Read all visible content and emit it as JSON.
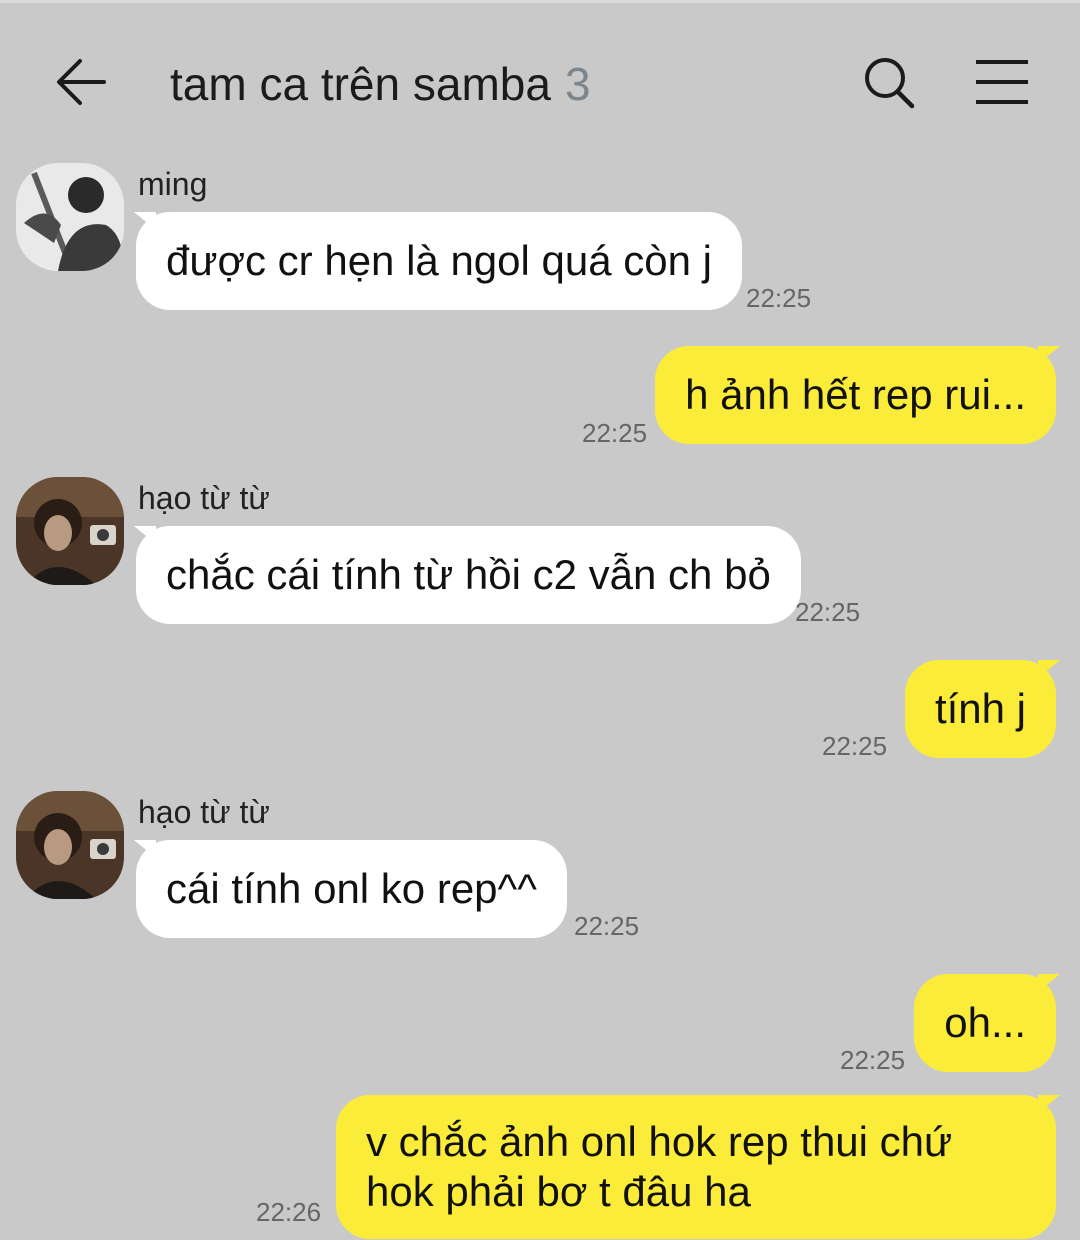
{
  "header": {
    "title": "tam ca trên samba",
    "member_count": "3",
    "back_icon": "back-arrow-icon",
    "search_icon": "search-icon",
    "menu_icon": "hamburger-menu-icon"
  },
  "colors": {
    "background": "#c9c9c9",
    "incoming_bubble": "#ffffff",
    "outgoing_bubble": "#fcec3a",
    "count_text": "#7e868d"
  },
  "messages": [
    {
      "sender": "ming",
      "text": "được cr hẹn là ngol quá còn j",
      "time": "22:25"
    },
    {
      "text": "h ảnh hết rep rui...",
      "time": "22:25"
    },
    {
      "sender": "hạo từ từ",
      "text": "chắc cái tính từ hồi c2 vẫn ch bỏ",
      "time": "22:25"
    },
    {
      "text": "tính j",
      "time": "22:25"
    },
    {
      "sender": "hạo từ từ",
      "text": "cái tính onl ko rep^^",
      "time": "22:25"
    },
    {
      "text": "oh...",
      "time": "22:25"
    },
    {
      "text": "v chắc ảnh onl hok rep thui chứ hok phải bơ t đâu ha",
      "time": "22:26"
    }
  ]
}
